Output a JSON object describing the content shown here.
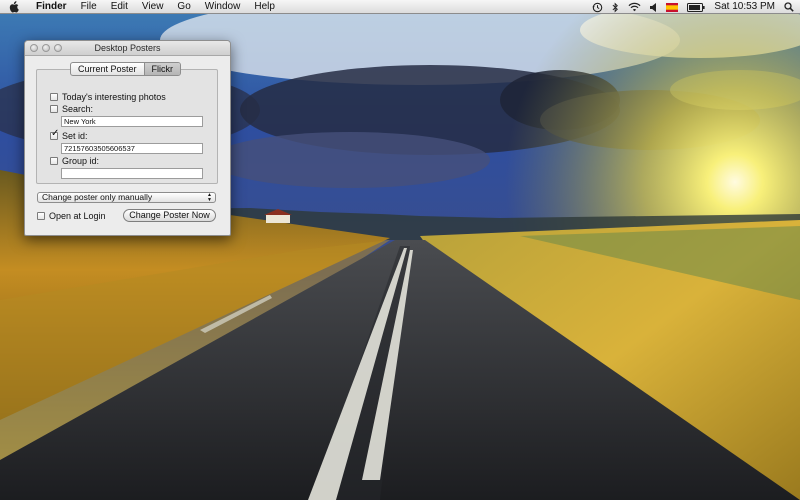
{
  "menubar": {
    "apple_icon": "apple-logo-icon",
    "app_name": "Finder",
    "menus": [
      "File",
      "Edit",
      "View",
      "Go",
      "Window",
      "Help"
    ],
    "status_icons": [
      "time-machine-icon",
      "bluetooth-icon",
      "wifi-icon",
      "volume-icon",
      "input-source-flag-icon",
      "battery-icon"
    ],
    "clock": "Sat 10:53 PM",
    "search_icon": "spotlight-icon"
  },
  "window": {
    "title": "Desktop Posters",
    "tabs": [
      {
        "label": "Current Poster",
        "selected": false
      },
      {
        "label": "Flickr",
        "selected": true
      }
    ],
    "interesting": {
      "label": "Today's interesting photos",
      "checked": false
    },
    "search": {
      "label": "Search:",
      "checked": false,
      "value": "New York"
    },
    "set_id": {
      "label": "Set id:",
      "checked": true,
      "value": "72157603505606537"
    },
    "group_id": {
      "label": "Group id:",
      "checked": false,
      "value": ""
    },
    "poster_mode": {
      "selected": "Change poster only manually"
    },
    "open_at_login": {
      "label": "Open at Login",
      "checked": false
    },
    "change_button": "Change Poster Now"
  },
  "colors": {
    "sky_blue": "#2f4fa0",
    "sun_yellow": "#f4e65a",
    "grass_gold": "#c99a28",
    "road_gray": "#2e3033"
  }
}
